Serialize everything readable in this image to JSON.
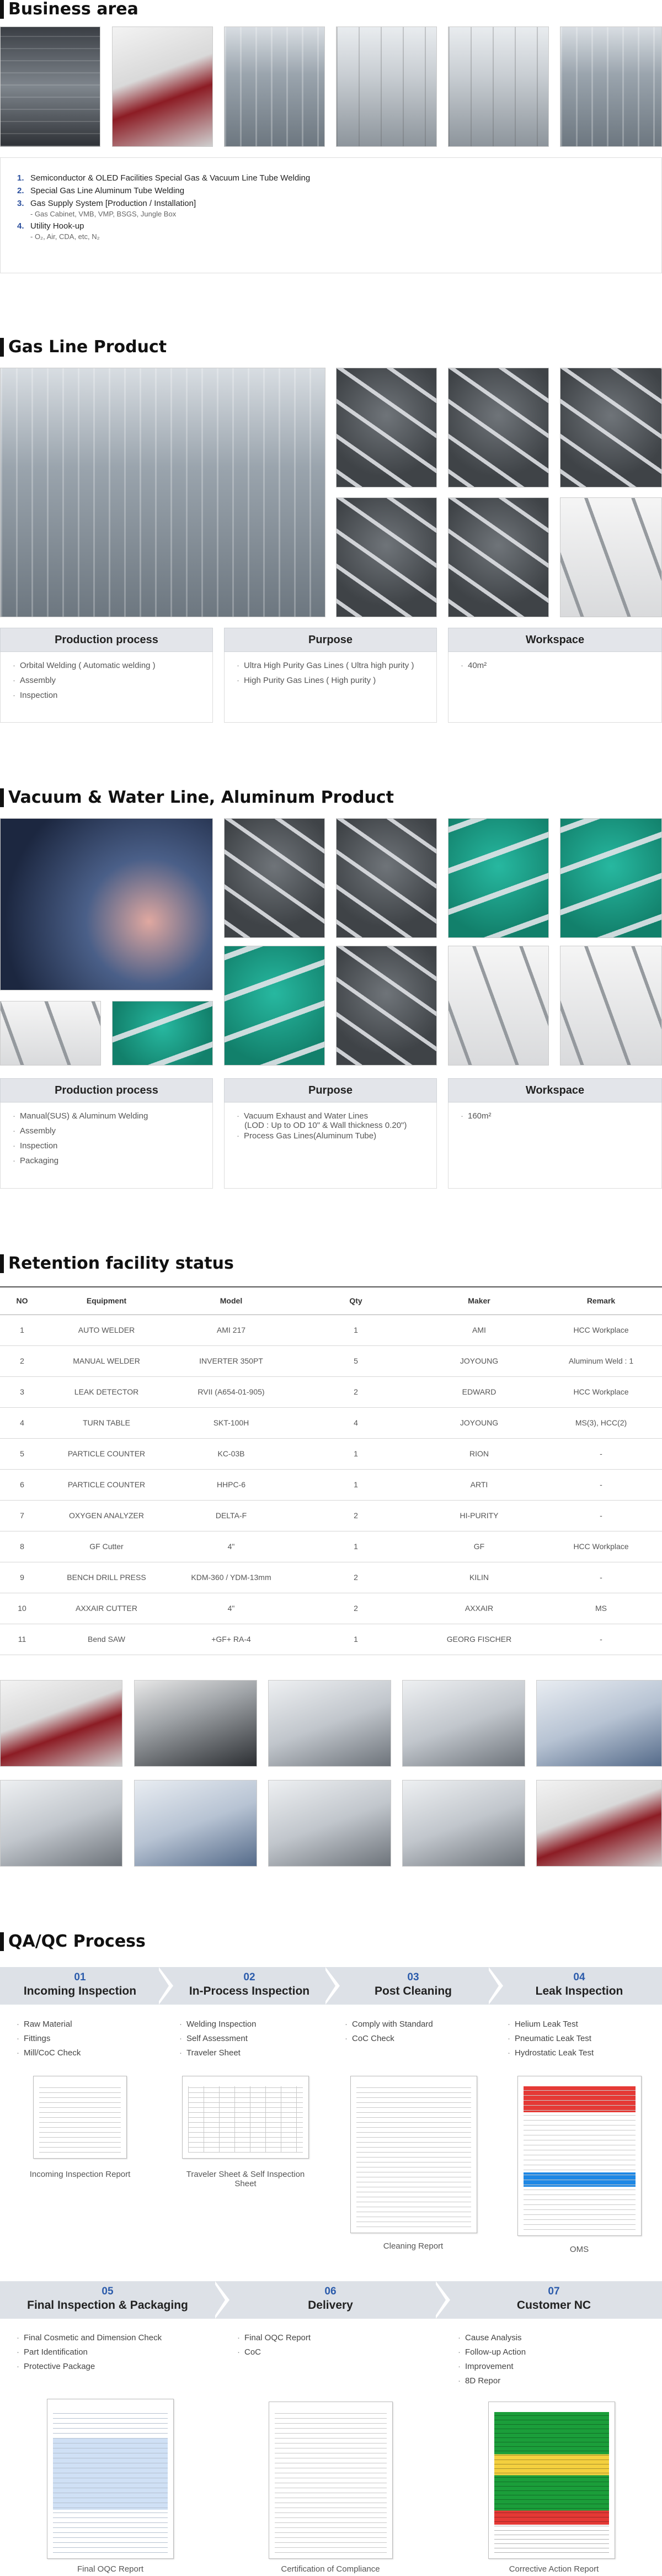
{
  "business_area": {
    "title": "Business area",
    "items": [
      {
        "num": "1.",
        "text": "Semiconductor & OLED Facilities Special Gas & Vacuum Line Tube Welding"
      },
      {
        "num": "2.",
        "text": "Special Gas Line Aluminum Tube Welding"
      },
      {
        "num": "3.",
        "text": "Gas Supply System [Production / Installation]",
        "sub": "- Gas Cabinet, VMB, VMP, BSGS, Jungle Box"
      },
      {
        "num": "4.",
        "text": "Utility Hook-up",
        "sub": "- O₂, Air, CDA, etc, N₂"
      }
    ]
  },
  "gas_line": {
    "title": "Gas Line Product",
    "production_process": {
      "head": "Production process",
      "items": [
        "Orbital Welding ( Automatic welding )",
        "Assembly",
        "Inspection"
      ]
    },
    "purpose": {
      "head": "Purpose",
      "items": [
        "Ultra High Purity Gas Lines ( Ultra high purity )",
        "High Purity Gas Lines ( High purity )"
      ]
    },
    "workspace": {
      "head": "Workspace",
      "items": [
        "40m²"
      ]
    }
  },
  "vacuum": {
    "title": "Vacuum & Water Line, Aluminum Product",
    "production_process": {
      "head": "Production process",
      "items": [
        "Manual(SUS) & Aluminum Welding",
        "Assembly",
        "Inspection",
        "Packaging"
      ]
    },
    "purpose": {
      "head": "Purpose",
      "items": [
        "Vacuum Exhaust and Water Lines",
        "(LOD : Up to OD 10\" & Wall thickness 0.20\")",
        "Process Gas Lines(Aluminum Tube)"
      ]
    },
    "workspace": {
      "head": "Workspace",
      "items": [
        "160m²"
      ]
    }
  },
  "retention": {
    "title": "Retention facility status",
    "columns": [
      "NO",
      "Equipment",
      "Model",
      "Qty",
      "Maker",
      "Remark"
    ],
    "rows": [
      [
        "1",
        "AUTO WELDER",
        "AMI 217",
        "1",
        "AMI",
        "HCC Workplace"
      ],
      [
        "2",
        "MANUAL WELDER",
        "INVERTER 350PT",
        "5",
        "JOYOUNG",
        "Aluminum Weld : 1"
      ],
      [
        "3",
        "LEAK DETECTOR",
        "RVII (A654-01-905)",
        "2",
        "EDWARD",
        "HCC Workplace"
      ],
      [
        "4",
        "TURN TABLE",
        "SKT-100H",
        "4",
        "JOYOUNG",
        "MS(3), HCC(2)"
      ],
      [
        "5",
        "PARTICLE COUNTER",
        "KC-03B",
        "1",
        "RION",
        "-"
      ],
      [
        "6",
        "PARTICLE COUNTER",
        "HHPC-6",
        "1",
        "ARTI",
        "-"
      ],
      [
        "7",
        "OXYGEN ANALYZER",
        "DELTA-F",
        "2",
        "HI-PURITY",
        "-"
      ],
      [
        "8",
        "GF Cutter",
        "4\"",
        "1",
        "GF",
        "HCC Workplace"
      ],
      [
        "9",
        "BENCH DRILL PRESS",
        "KDM-360 / YDM-13mm",
        "2",
        "KILIN",
        "-"
      ],
      [
        "10",
        "AXXAIR CUTTER",
        "4\"",
        "2",
        "AXXAIR",
        "MS"
      ],
      [
        "11",
        "Bend SAW",
        "+GF+ RA-4",
        "1",
        "GEORG FISCHER",
        "-"
      ]
    ]
  },
  "qa": {
    "title": "QA/QC Process",
    "steps": [
      {
        "num": "01",
        "title": "Incoming Inspection",
        "items": [
          "Raw Material",
          "Fittings",
          "Mill/CoC Check"
        ],
        "caption": "Incoming Inspection Report"
      },
      {
        "num": "02",
        "title": "In-Process Inspection",
        "items": [
          "Welding Inspection",
          "Self Assessment",
          "Traveler Sheet"
        ],
        "caption": "Traveler Sheet & Self Inspection Sheet"
      },
      {
        "num": "03",
        "title": "Post Cleaning",
        "items": [
          "Comply with Standard",
          "CoC Check"
        ],
        "caption": "Cleaning Report"
      },
      {
        "num": "04",
        "title": "Leak Inspection",
        "items": [
          "Helium Leak Test",
          "Pneumatic Leak Test",
          "Hydrostatic Leak Test"
        ],
        "caption": "OMS"
      },
      {
        "num": "05",
        "title": "Final Inspection & Packaging",
        "items": [
          "Final Cosmetic and Dimension Check",
          "Part Identification",
          "Protective Package"
        ],
        "caption": "Final OQC Report"
      },
      {
        "num": "06",
        "title": "Delivery",
        "items": [
          "Final OQC Report",
          "CoC"
        ],
        "caption": "Certification of Compliance"
      },
      {
        "num": "07",
        "title": "Customer NC",
        "items": [
          "Cause Analysis",
          "Follow-up Action",
          "Improvement",
          "8D Repor"
        ],
        "caption": "Corrective Action Report"
      }
    ]
  },
  "colors": {
    "accent": "#2b5bab",
    "header_bg": "#e3e5ea",
    "step_bg": "#dde1e7"
  }
}
